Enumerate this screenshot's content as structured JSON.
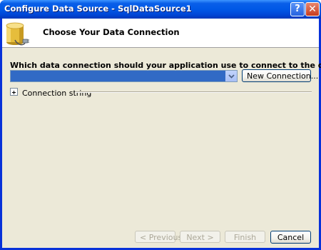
{
  "window": {
    "title": "Configure Data Source - SqlDataSource1",
    "help_label": "?",
    "close_label": "✕"
  },
  "header": {
    "title": "Choose Your Data Connection",
    "icon": "database-plug-icon"
  },
  "connection": {
    "question": "Which data connection should your application use to connect to the database?",
    "selected_value": "",
    "new_connection_label": "New Connection...",
    "connection_string_label": "Connection string",
    "expand_icon": "plus-icon"
  },
  "footer": {
    "previous_label": "< Previous",
    "next_label": "Next >",
    "finish_label": "Finish",
    "cancel_label": "Cancel"
  },
  "colors": {
    "title_bar": "#0058e6",
    "selection": "#316ac5",
    "dialog_face": "#ece9d8"
  }
}
